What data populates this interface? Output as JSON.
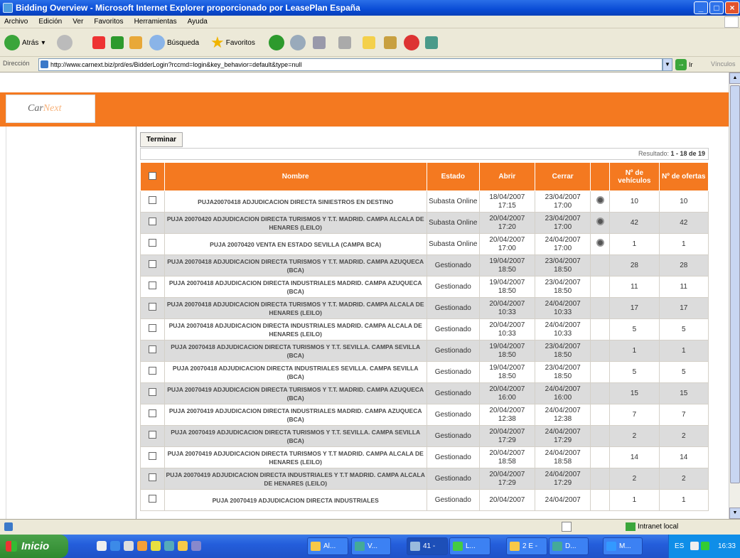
{
  "window": {
    "title": "Bidding Overview - Microsoft Internet Explorer proporcionado por LeasePlan España"
  },
  "menu": [
    "Archivo",
    "Edición",
    "Ver",
    "Favoritos",
    "Herramientas",
    "Ayuda"
  ],
  "toolbar": {
    "back_label": "Atrás",
    "search_label": "Búsqueda",
    "favorites_label": "Favoritos"
  },
  "address": {
    "label": "Dirección",
    "url": "http://www.carnext.biz/prd/es/BidderLogin?rccmd=login&key_behavior=default&type=null",
    "go_label": "Ir",
    "links_label": "Vínculos"
  },
  "page": {
    "logo_text_a": "Car",
    "logo_text_b": "Next",
    "terminate_button": "Terminar",
    "results_prefix": "Resultado: ",
    "results_range": "1 - 18 de 19",
    "columns": {
      "name": "Nombre",
      "state": "Estado",
      "open": "Abrir",
      "close": "Cerrar",
      "vehicles": "Nº de vehículos",
      "offers": "Nº de ofertas"
    },
    "rows": [
      {
        "name": "PUJA20070418 ADJUDICACION DIRECTA SINIESTROS EN DESTINO",
        "state": "Subasta Online",
        "open": "18/04/2007 17:15",
        "close": "23/04/2007 17:00",
        "has_view": true,
        "vehicles": "10",
        "offers": "10"
      },
      {
        "name": "PUJA 20070420 ADJUDICACION DIRECTA TURISMOS Y T.T. MADRID. CAMPA ALCALA DE HENARES (LEILO)",
        "state": "Subasta Online",
        "open": "20/04/2007 17:20",
        "close": "23/04/2007 17:00",
        "has_view": true,
        "vehicles": "42",
        "offers": "42"
      },
      {
        "name": "PUJA 20070420 VENTA EN ESTADO SEVILLA (CAMPA BCA)",
        "state": "Subasta Online",
        "open": "20/04/2007 17:00",
        "close": "24/04/2007 17:00",
        "has_view": true,
        "vehicles": "1",
        "offers": "1"
      },
      {
        "name": "PUJA 20070418 ADJUDICACION DIRECTA TURISMOS Y T.T. MADRID. CAMPA AZUQUECA (BCA)",
        "state": "Gestionado",
        "open": "19/04/2007 18:50",
        "close": "23/04/2007 18:50",
        "has_view": false,
        "vehicles": "28",
        "offers": "28"
      },
      {
        "name": "PUJA 20070418 ADJUDICACION DIRECTA INDUSTRIALES MADRID. CAMPA AZUQUECA (BCA)",
        "state": "Gestionado",
        "open": "19/04/2007 18:50",
        "close": "23/04/2007 18:50",
        "has_view": false,
        "vehicles": "11",
        "offers": "11"
      },
      {
        "name": "PUJA 20070418 ADJUDICACION DIRECTA TURISMOS Y T.T. MADRID. CAMPA ALCALA DE HENARES (LEILO)",
        "state": "Gestionado",
        "open": "20/04/2007 10:33",
        "close": "24/04/2007 10:33",
        "has_view": false,
        "vehicles": "17",
        "offers": "17"
      },
      {
        "name": "PUJA 20070418 ADJUDICACION DIRECTA INDUSTRIALES MADRID. CAMPA ALCALA DE HENARES (LEILO)",
        "state": "Gestionado",
        "open": "20/04/2007 10:33",
        "close": "24/04/2007 10:33",
        "has_view": false,
        "vehicles": "5",
        "offers": "5"
      },
      {
        "name": "PUJA 20070418 ADJUDICACION DIRECTA TURISMOS Y T.T. SEVILLA. CAMPA SEVILLA (BCA)",
        "state": "Gestionado",
        "open": "19/04/2007 18:50",
        "close": "23/04/2007 18:50",
        "has_view": false,
        "vehicles": "1",
        "offers": "1"
      },
      {
        "name": "PUJA 20070418 ADJUDICACION DIRECTA INDUSTRIALES SEVILLA. CAMPA SEVILLA (BCA)",
        "state": "Gestionado",
        "open": "19/04/2007 18:50",
        "close": "23/04/2007 18:50",
        "has_view": false,
        "vehicles": "5",
        "offers": "5"
      },
      {
        "name": "PUJA 20070419 ADJUDICACION DIRECTA TURISMOS Y T.T. MADRID. CAMPA AZUQUECA (BCA)",
        "state": "Gestionado",
        "open": "20/04/2007 16:00",
        "close": "24/04/2007 16:00",
        "has_view": false,
        "vehicles": "15",
        "offers": "15"
      },
      {
        "name": "PUJA 20070419 ADJUDICACION DIRECTA INDUSTRIALES MADRID. CAMPA AZUQUECA (BCA)",
        "state": "Gestionado",
        "open": "20/04/2007 12:38",
        "close": "24/04/2007 12:38",
        "has_view": false,
        "vehicles": "7",
        "offers": "7"
      },
      {
        "name": "PUJA 20070419 ADJUDICACION DIRECTA TURISMOS Y T.T. SEVILLA. CAMPA SEVILLA (BCA)",
        "state": "Gestionado",
        "open": "20/04/2007 17:29",
        "close": "24/04/2007 17:29",
        "has_view": false,
        "vehicles": "2",
        "offers": "2"
      },
      {
        "name": "PUJA 20070419 ADJUDICACION DIRECTA TURISMOS Y T.T MADRID. CAMPA ALCALA DE HENARES (LEILO)",
        "state": "Gestionado",
        "open": "20/04/2007 18:58",
        "close": "24/04/2007 18:58",
        "has_view": false,
        "vehicles": "14",
        "offers": "14"
      },
      {
        "name": "PUJA 20070419 ADJUDICACION DIRECTA INDUSTRIALES Y T.T MADRID. CAMPA ALCALA DE HENARES (LEILO)",
        "state": "Gestionado",
        "open": "20/04/2007 17:29",
        "close": "24/04/2007 17:29",
        "has_view": false,
        "vehicles": "2",
        "offers": "2"
      },
      {
        "name": "PUJA 20070419 ADJUDICACION DIRECTA INDUSTRIALES",
        "state": "Gestionado",
        "open": "20/04/2007",
        "close": "24/04/2007",
        "has_view": false,
        "vehicles": "1",
        "offers": "1"
      }
    ]
  },
  "statusbar": {
    "zone": "Intranet local"
  },
  "taskbar": {
    "start_label": "Inicio",
    "tasks": [
      "Al...",
      "V...",
      "41 -",
      "L...",
      "2 E -",
      "D...",
      "M..."
    ],
    "lang": "ES",
    "clock": "16:33"
  },
  "colors": {
    "accent": "#f47920",
    "header_text": "#ffffff",
    "alt_row": "#dcdcdc"
  }
}
